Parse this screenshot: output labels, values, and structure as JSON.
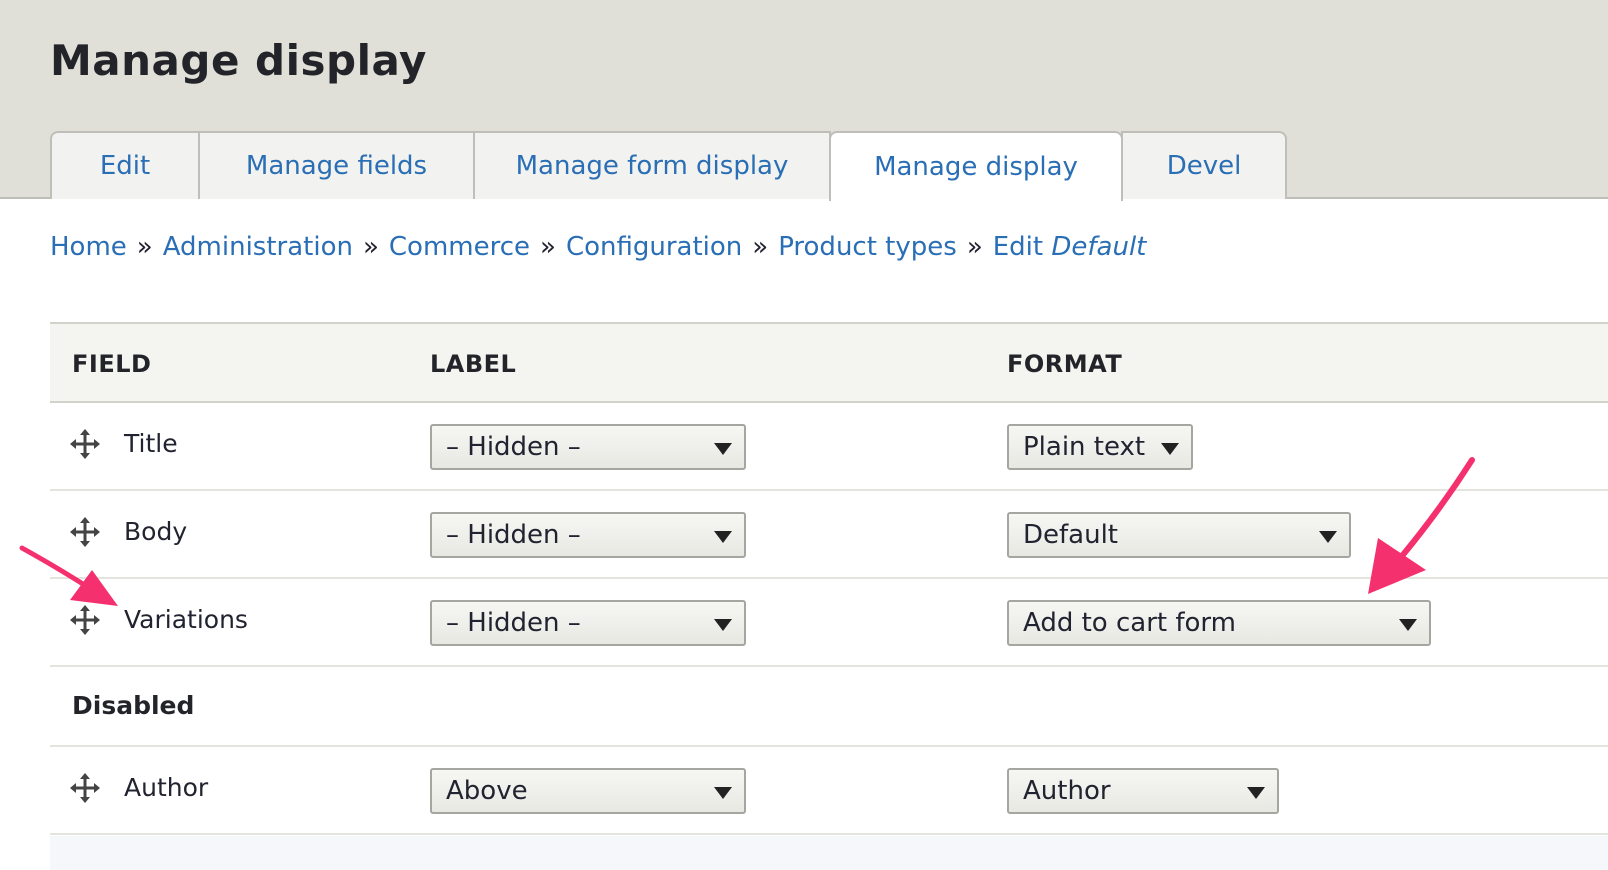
{
  "page": {
    "title": "Manage display"
  },
  "tabs": [
    {
      "label": "Edit",
      "active": false
    },
    {
      "label": "Manage fields",
      "active": false
    },
    {
      "label": "Manage form display",
      "active": false
    },
    {
      "label": "Manage display",
      "active": true
    },
    {
      "label": "Devel",
      "active": false
    }
  ],
  "breadcrumb": {
    "items": [
      "Home",
      "Administration",
      "Commerce",
      "Configuration",
      "Product types"
    ],
    "separator": "»",
    "last_prefix": "Edit",
    "last_emphasis": "Default"
  },
  "table": {
    "headers": {
      "field": "FIELD",
      "label": "LABEL",
      "format": "FORMAT"
    },
    "rows": [
      {
        "name": "Title",
        "label": "– Hidden –",
        "format": "Plain text"
      },
      {
        "name": "Body",
        "label": "– Hidden –",
        "format": "Default"
      },
      {
        "name": "Variations",
        "label": "– Hidden –",
        "format": "Add to cart form"
      }
    ],
    "disabled_region": {
      "title": "Disabled",
      "rows": [
        {
          "name": "Author",
          "label": "Above",
          "format": "Author"
        }
      ]
    }
  },
  "icons": {
    "drag": "move-arrows-icon",
    "caret": "caret-down-icon"
  },
  "colors": {
    "link": "#2a6eb5",
    "header_bg": "#e0e0d8",
    "annotation_arrow": "#f5306f"
  }
}
